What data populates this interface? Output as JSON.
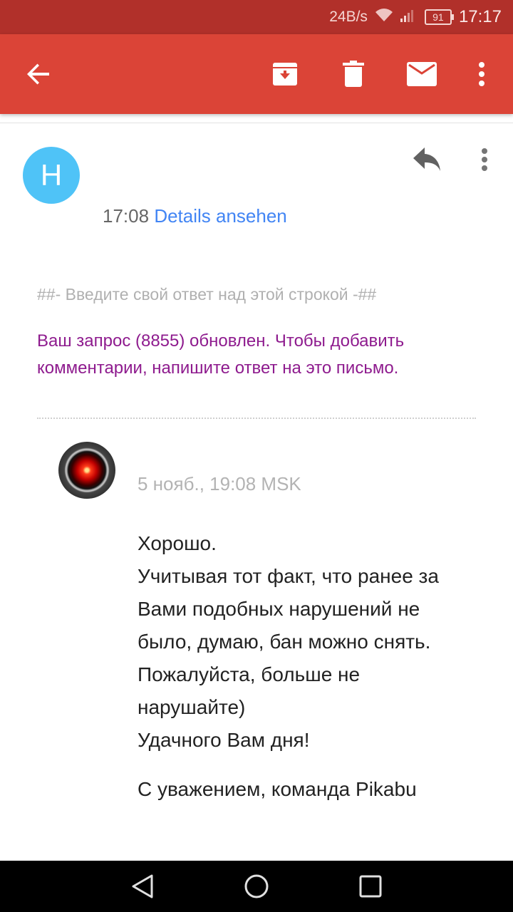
{
  "status_bar": {
    "network_speed": "24B/s",
    "battery_level": "91",
    "time": "17:17"
  },
  "toolbar": {
    "back_icon": "arrow-left-icon",
    "archive_icon": "archive-icon",
    "delete_icon": "trash-icon",
    "mark_unread_icon": "mail-icon",
    "more_icon": "more-vert-icon",
    "background_color": "#db4437"
  },
  "message_header": {
    "avatar_letter": "H",
    "avatar_color": "#4fc3f7",
    "time": "17:08",
    "details_link": "Details ansehen"
  },
  "email": {
    "reply_hint": "##- Введите свой ответ над этой строкой -##",
    "notice_line1": "Ваш запрос (8855) обновлен. Чтобы добавить",
    "notice_line2": "комментарии, напишите ответ на это письмо.",
    "quoted_message": {
      "date": "5 нояб., 19:08 MSK",
      "lines": [
        "Хорошо.",
        "Учитывая тот факт, что ранее за",
        "Вами подобных нарушений не",
        "было, думаю, бан можно снять.",
        "Пожалуйста, больше не",
        "нарушайте)",
        "Удачного Вам дня!"
      ],
      "signature": "С уважением, команда Pikabu"
    }
  },
  "nav_bar": {
    "back_icon": "nav-back-icon",
    "home_icon": "nav-home-icon",
    "recents_icon": "nav-recents-icon"
  }
}
